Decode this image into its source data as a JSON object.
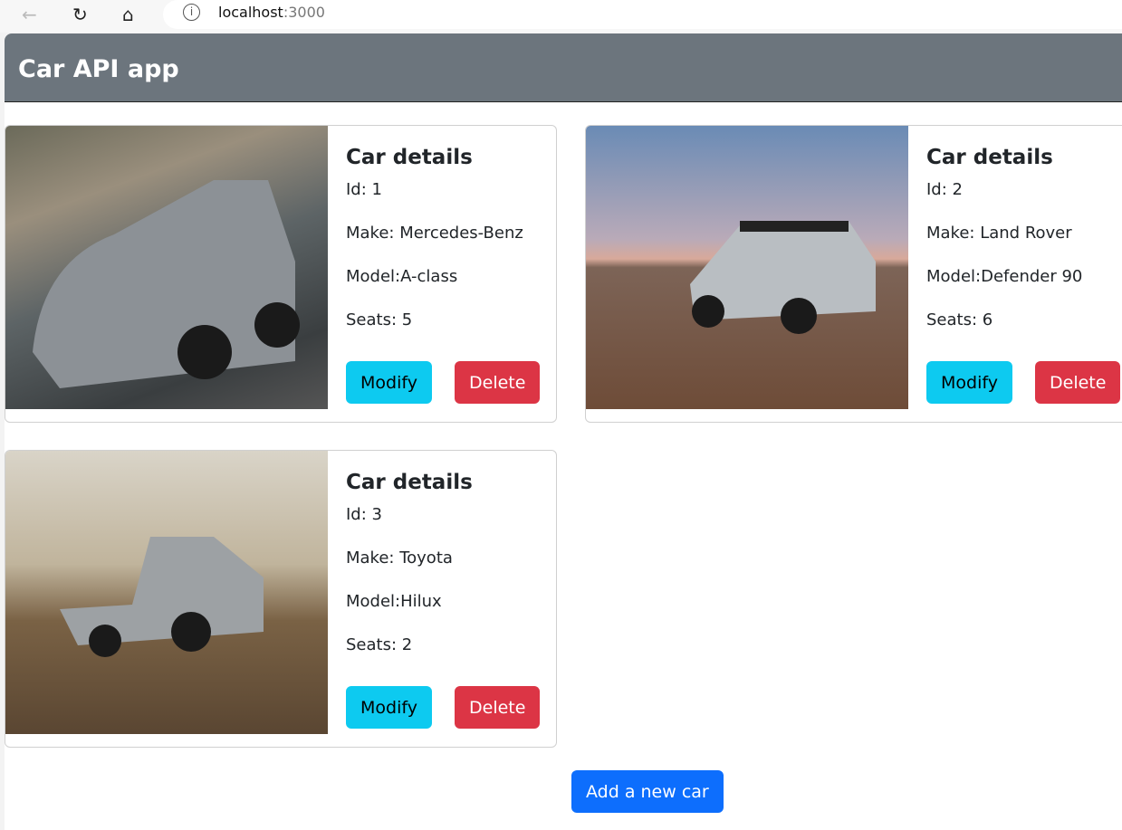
{
  "browser": {
    "url_host": "localhost",
    "url_port": ":3000"
  },
  "header": {
    "title": "Car API app"
  },
  "cars": [
    {
      "heading": "Car details",
      "id": "Id: 1",
      "make": "Make: Mercedes-Benz",
      "model": "Model:A-class",
      "seats": "Seats: 5",
      "modify": "Modify",
      "delete": "Delete"
    },
    {
      "heading": "Car details",
      "id": "Id: 2",
      "make": "Make: Land Rover",
      "model": "Model:Defender 90",
      "seats": "Seats: 6",
      "modify": "Modify",
      "delete": "Delete"
    },
    {
      "heading": "Car details",
      "id": "Id: 3",
      "make": "Make: Toyota",
      "model": "Model:Hilux",
      "seats": "Seats: 2",
      "modify": "Modify",
      "delete": "Delete"
    }
  ],
  "add_button": "Add a new car",
  "colors": {
    "header": "#6c757d",
    "modify": "#0dcaf0",
    "delete": "#dc3545",
    "add": "#0d6efd"
  }
}
